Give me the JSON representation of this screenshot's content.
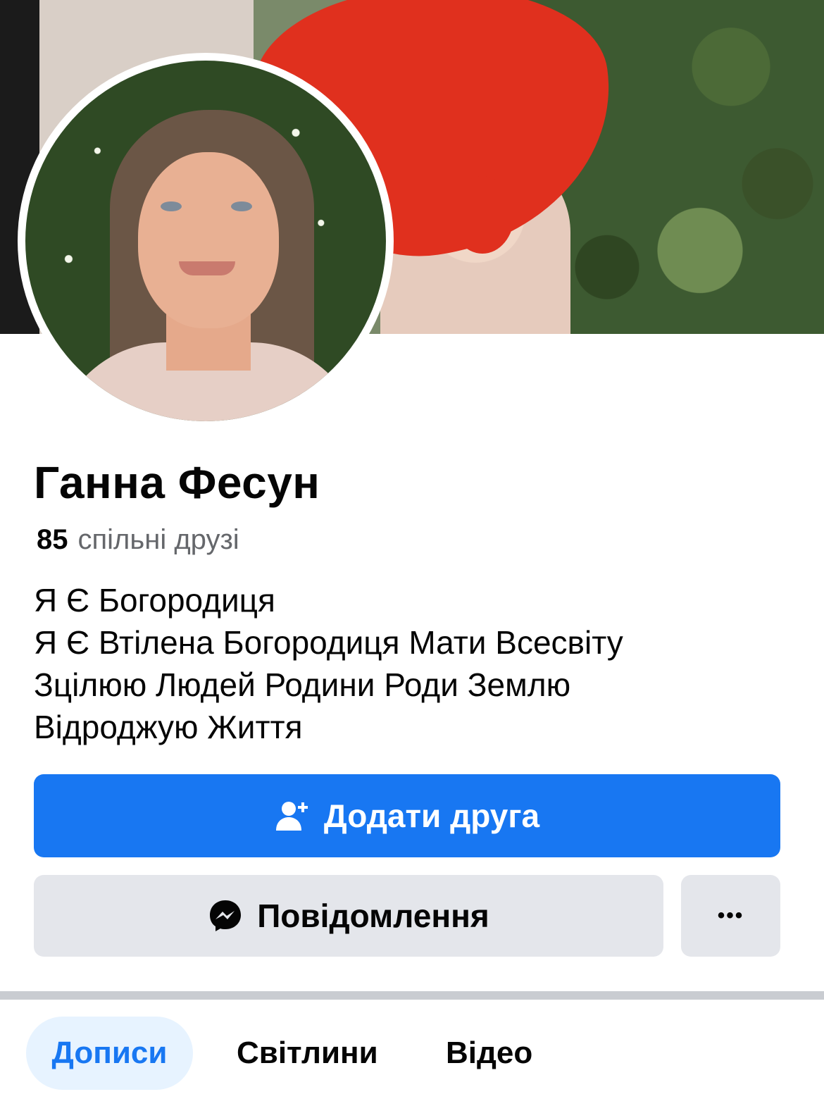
{
  "profile": {
    "name": "Ганна Фесун",
    "mutual_count": "85",
    "mutual_label": "спільні друзі",
    "bio": [
      "Я Є Богородиця",
      "Я Є Втілена Богородиця Мати Всесвіту",
      "Зцілюю Людей Родини Роди Землю",
      "Відроджую Життя"
    ]
  },
  "actions": {
    "add_friend": "Додати друга",
    "message": "Повідомлення",
    "more": "•••"
  },
  "tabs": {
    "posts": "Дописи",
    "photos": "Світлини",
    "videos": "Відео",
    "active": "posts"
  },
  "colors": {
    "primary": "#1877f2",
    "secondary_button": "#e4e6eb",
    "active_tab_bg": "#e7f3ff",
    "muted_text": "#65676b",
    "redaction": "#e0301e"
  },
  "icons": [
    "add-friend-icon",
    "messenger-icon",
    "more-icon"
  ]
}
